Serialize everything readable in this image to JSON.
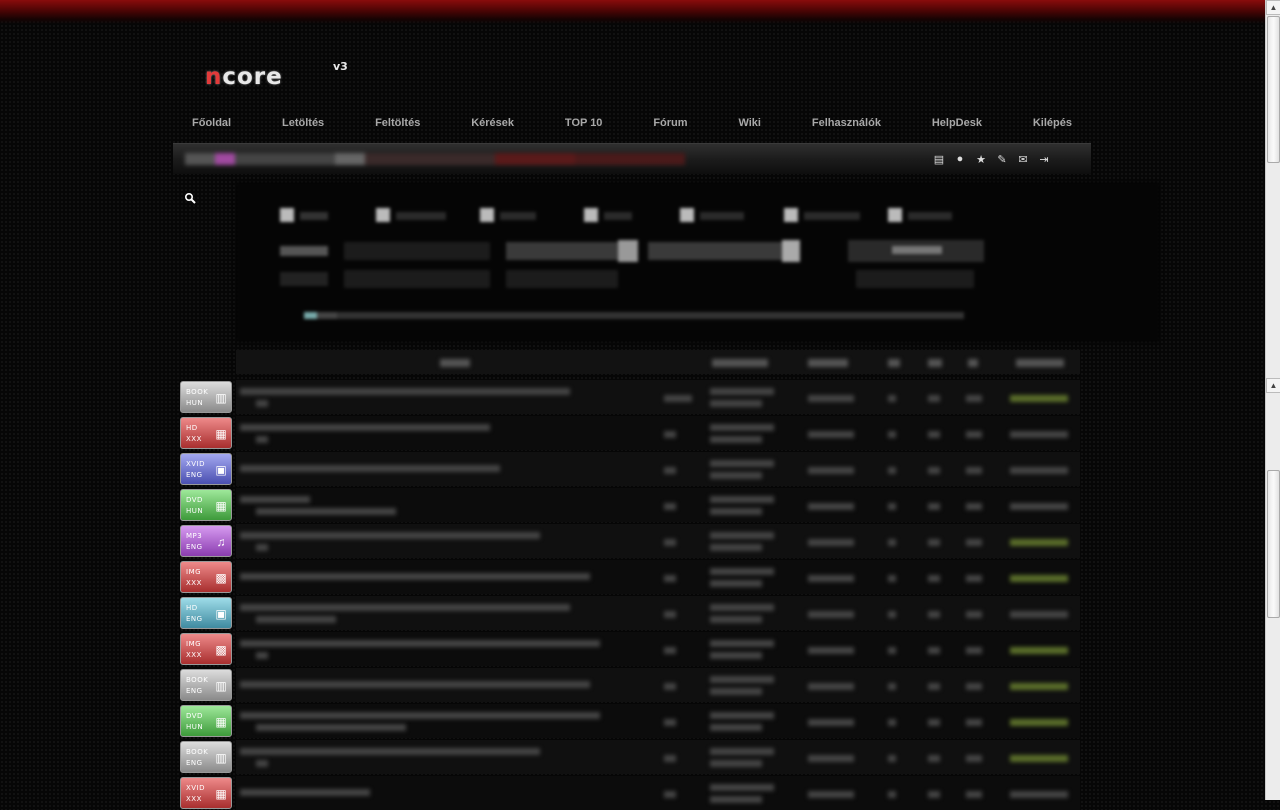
{
  "logo": {
    "text_n": "n",
    "text_rest": "core",
    "version": "v3"
  },
  "nav": {
    "items": [
      {
        "label": "Főoldal"
      },
      {
        "label": "Letöltés"
      },
      {
        "label": "Feltöltés"
      },
      {
        "label": "Kérések"
      },
      {
        "label": "TOP 10"
      },
      {
        "label": "Fórum"
      },
      {
        "label": "Wiki"
      },
      {
        "label": "Felhasználók"
      },
      {
        "label": "HelpDesk"
      },
      {
        "label": "Kilépés"
      }
    ]
  },
  "userbar": {
    "icons": [
      "document-icon",
      "user-icon",
      "star-icon",
      "wrench-icon",
      "mail-icon",
      "logout-icon"
    ],
    "glyphs": [
      "▤",
      "●",
      "★",
      "✎",
      "✉",
      "⇥"
    ]
  },
  "search": {
    "icon": "search-icon",
    "glyph": "🔍"
  },
  "torrents": {
    "rows": [
      {
        "cat1": "BOOK",
        "cat2": "HUN",
        "color": "grey",
        "icon": "book-icon",
        "glyph": "▥"
      },
      {
        "cat1": "HD",
        "cat2": "XXX",
        "color": "red",
        "icon": "film-icon",
        "glyph": "▦"
      },
      {
        "cat1": "XVID",
        "cat2": "ENG",
        "color": "blue",
        "icon": "tv-icon",
        "glyph": "▣"
      },
      {
        "cat1": "DVD",
        "cat2": "HUN",
        "color": "green",
        "icon": "film-icon",
        "glyph": "▦"
      },
      {
        "cat1": "MP3",
        "cat2": "ENG",
        "color": "purple",
        "icon": "music-icon",
        "glyph": "♫"
      },
      {
        "cat1": "IMG",
        "cat2": "XXX",
        "color": "red",
        "icon": "image-icon",
        "glyph": "▩"
      },
      {
        "cat1": "HD",
        "cat2": "ENG",
        "color": "teal",
        "icon": "tv-icon",
        "glyph": "▣"
      },
      {
        "cat1": "IMG",
        "cat2": "XXX",
        "color": "red",
        "icon": "image-icon",
        "glyph": "▩"
      },
      {
        "cat1": "BOOK",
        "cat2": "ENG",
        "color": "grey",
        "icon": "book-icon",
        "glyph": "▥"
      },
      {
        "cat1": "DVD",
        "cat2": "HUN",
        "color": "green",
        "icon": "film-icon",
        "glyph": "▦"
      },
      {
        "cat1": "BOOK",
        "cat2": "ENG",
        "color": "grey",
        "icon": "book-icon",
        "glyph": "▥"
      },
      {
        "cat1": "XVID",
        "cat2": "XXX",
        "color": "red",
        "icon": "film-icon",
        "glyph": "▦"
      }
    ]
  }
}
